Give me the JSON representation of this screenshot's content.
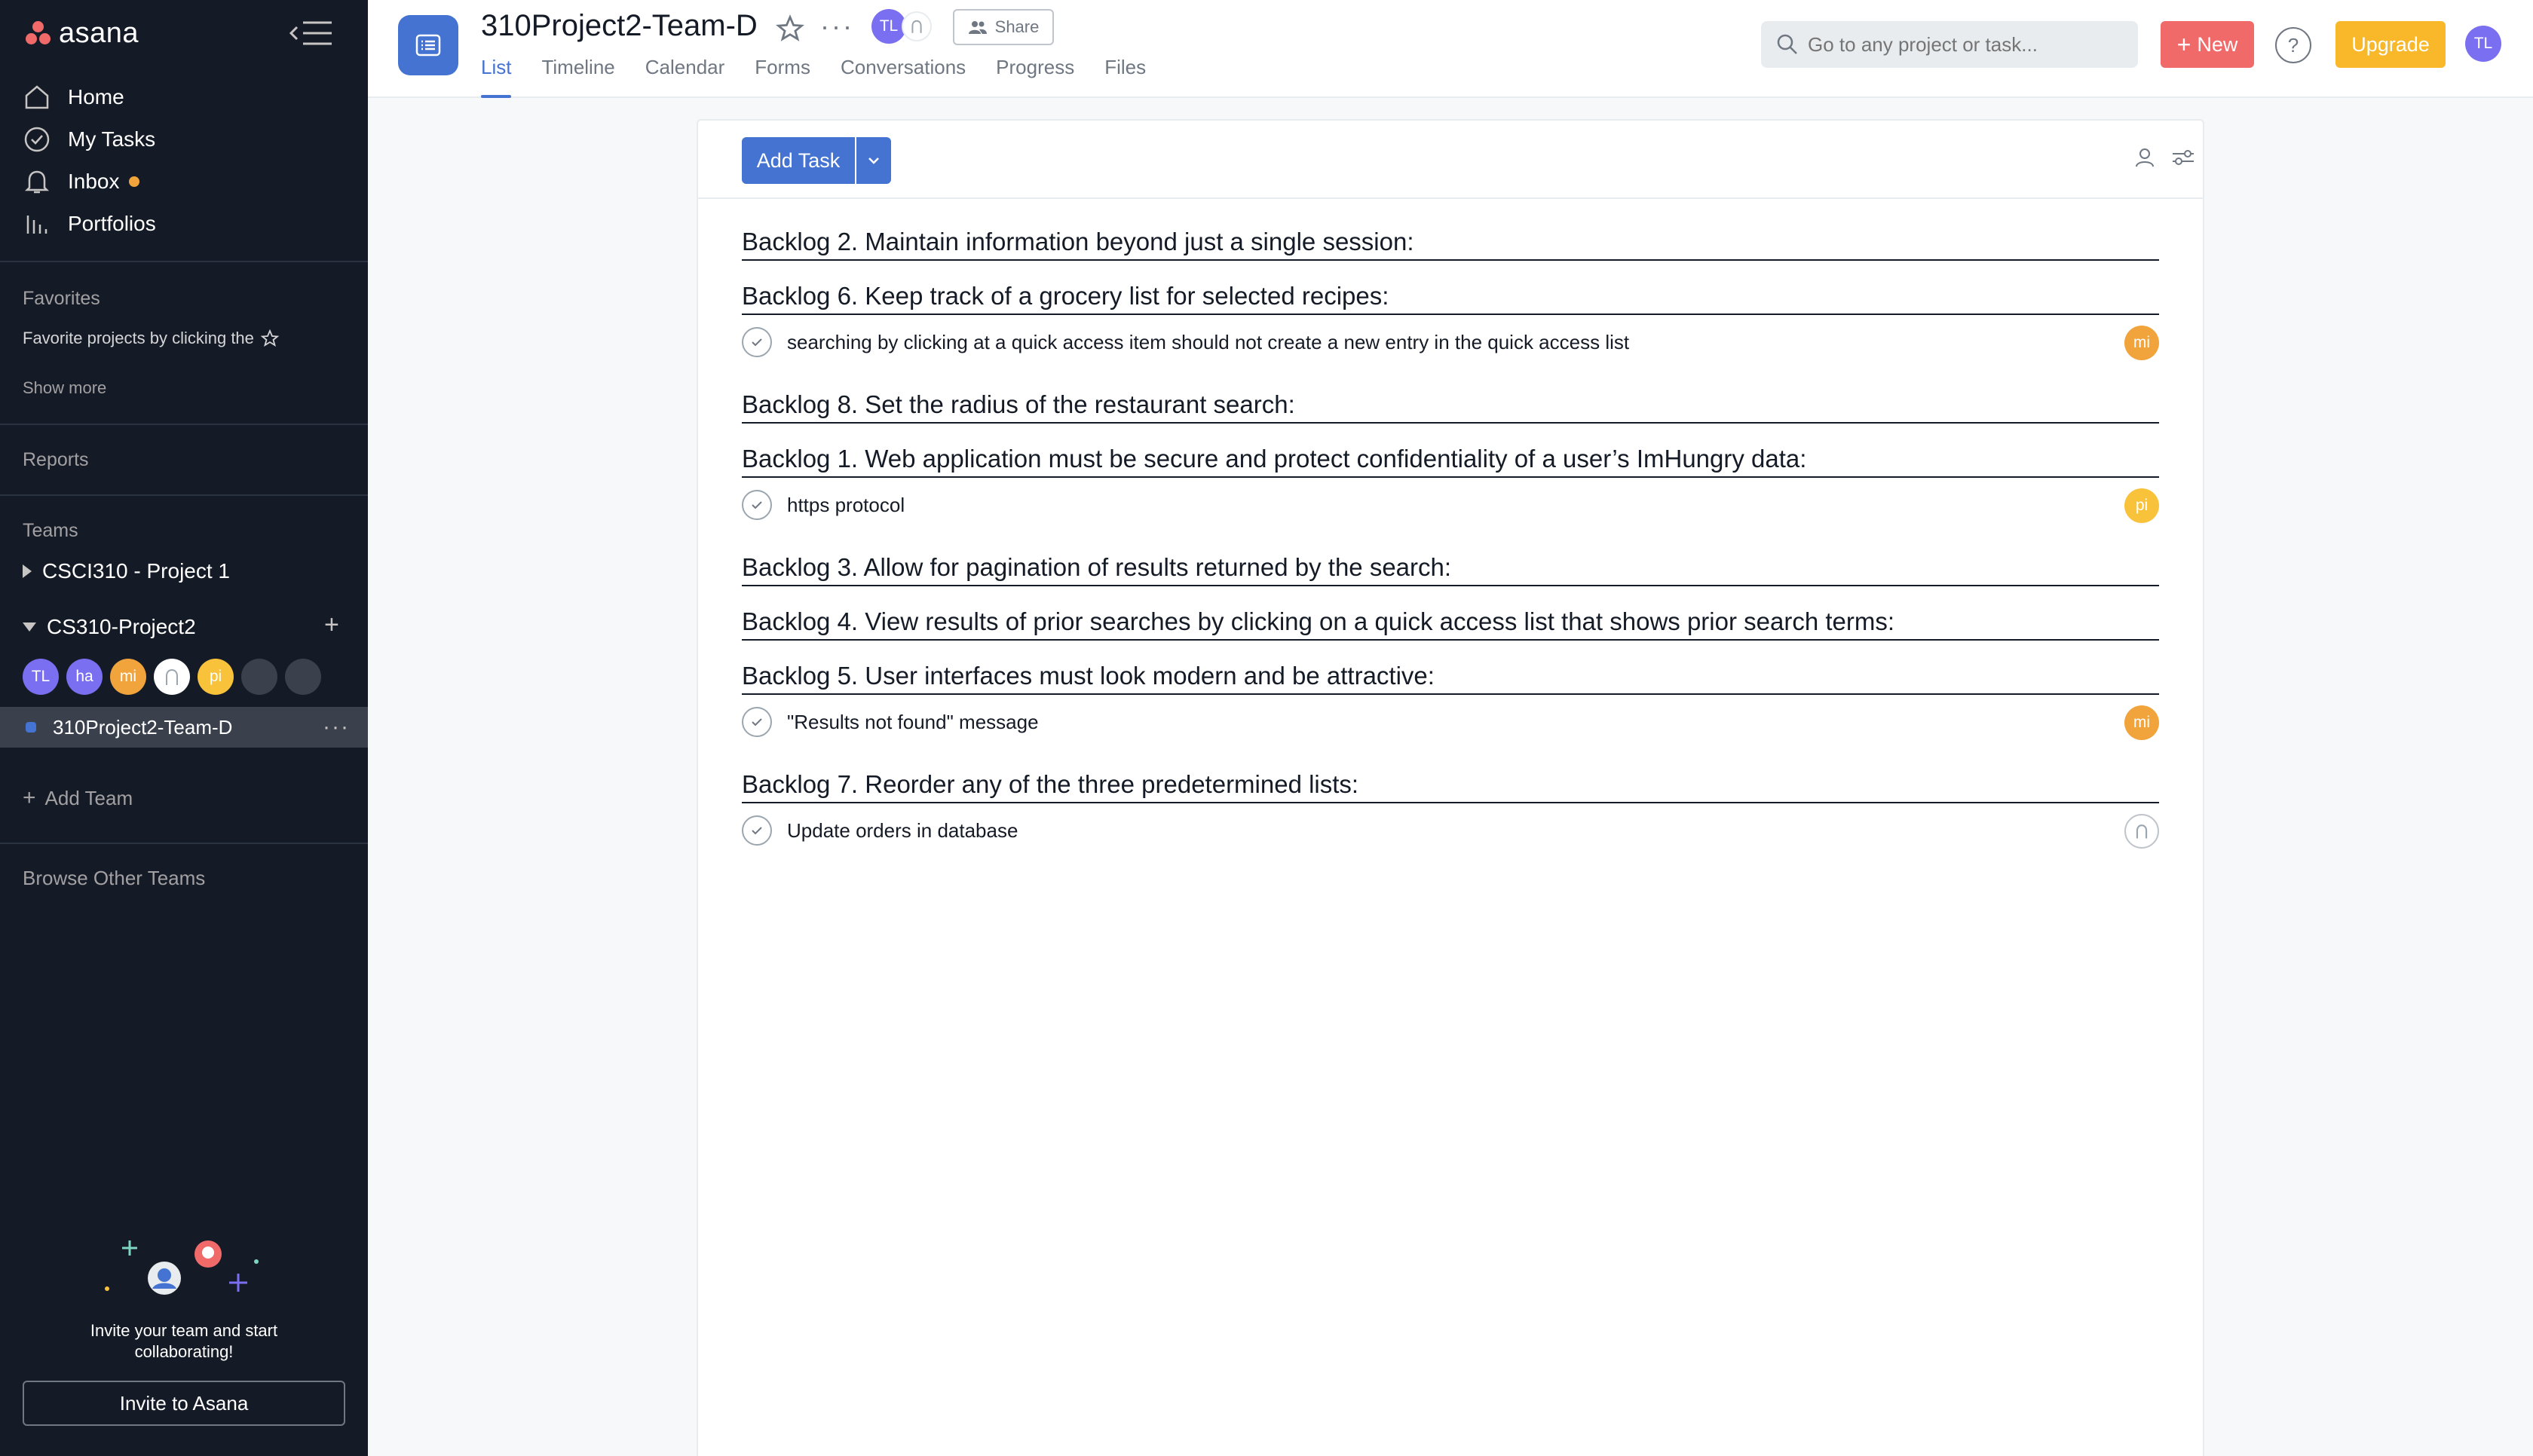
{
  "sidebar": {
    "logo": "asana",
    "nav": [
      {
        "label": "Home",
        "icon": "home-icon"
      },
      {
        "label": "My Tasks",
        "icon": "check-circle-icon"
      },
      {
        "label": "Inbox",
        "icon": "bell-icon"
      },
      {
        "label": "Portfolios",
        "icon": "bar-chart-icon"
      }
    ],
    "favorites_title": "Favorites",
    "favorites_hint": "Favorite projects by clicking the",
    "show_more": "Show more",
    "reports": "Reports",
    "teams_title": "Teams",
    "teams": [
      {
        "label": "CSCI310 - Project 1"
      },
      {
        "label": "CS310-Project2"
      }
    ],
    "members": [
      {
        "initials": "TL",
        "color": "#7a6ff0"
      },
      {
        "initials": "ha",
        "color": "#7a6ff0"
      },
      {
        "initials": "mi",
        "color": "#f1a33c"
      },
      {
        "initials": "",
        "color": "#ffffff"
      },
      {
        "initials": "pi",
        "color": "#f8c23a"
      },
      {
        "initials": "",
        "color": "#3a414d"
      },
      {
        "initials": "",
        "color": "#3a414d"
      }
    ],
    "project": "310Project2-Team-D",
    "add_team": "Add Team",
    "browse": "Browse Other Teams",
    "invite_text": "Invite your team and start collaborating!",
    "invite_button": "Invite to Asana"
  },
  "topbar": {
    "title": "310Project2-Team-D",
    "owner_initials": "TL",
    "share_label": "Share",
    "tabs": [
      "List",
      "Timeline",
      "Calendar",
      "Forms",
      "Conversations",
      "Progress",
      "Files"
    ],
    "active_tab": "List",
    "search_placeholder": "Go to any project or task...",
    "new_label": "New",
    "help_label": "?",
    "upgrade_label": "Upgrade",
    "user_initials": "TL"
  },
  "list": {
    "add_task_label": "Add Task",
    "sections": [
      {
        "title": "Backlog 2. Maintain information beyond just a single session:",
        "tasks": []
      },
      {
        "title": "Backlog 6. Keep track of a grocery list for selected recipes:",
        "tasks": [
          {
            "name": "searching by clicking at a quick access item should not create a new entry in the quick access list",
            "assignee": "mi",
            "color": "#f1a33c"
          }
        ]
      },
      {
        "title": "Backlog 8. Set the radius of the restaurant search:",
        "tasks": []
      },
      {
        "title": "Backlog 1. Web application must be secure and protect confidentiality of a user’s ImHungry data:",
        "tasks": [
          {
            "name": "https protocol",
            "assignee": "pi",
            "color": "#f8c23a"
          }
        ]
      },
      {
        "title": "Backlog 3. Allow for pagination of results returned by the search:",
        "tasks": []
      },
      {
        "title": "Backlog 4. View results of prior searches by clicking on a quick access list that shows prior search terms:",
        "tasks": []
      },
      {
        "title": "Backlog 5. User interfaces must look modern and be attractive:",
        "tasks": [
          {
            "name": "\"Results not found\" message",
            "assignee": "mi",
            "color": "#f1a33c"
          }
        ]
      },
      {
        "title": "Backlog 7.  Reorder any of the three predetermined lists:",
        "tasks": [
          {
            "name": "Update orders in database",
            "assignee": "",
            "color": "#ffffff"
          }
        ]
      }
    ]
  }
}
